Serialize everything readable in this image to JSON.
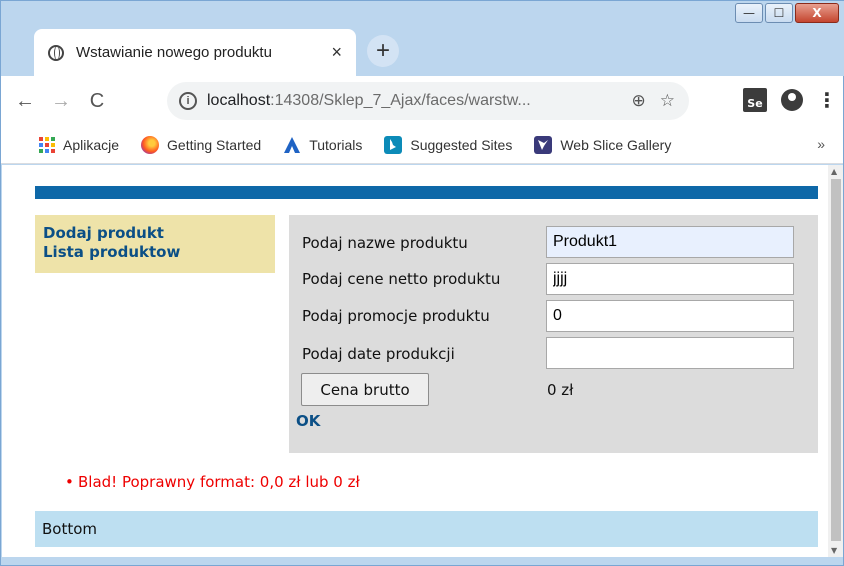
{
  "browser": {
    "tab_title": "Wstawianie nowego produktu",
    "tab_close": "×",
    "new_tab": "+",
    "url_host": "localhost",
    "url_path": ":14308/Sklep_7_Ajax/faces/warstw...",
    "info_glyph": "i",
    "window_buttons": {
      "minimize": "—",
      "maximize": "☐",
      "close": "X"
    },
    "nav": {
      "back": "←",
      "forward": "→",
      "reload": "C"
    },
    "omni_icons": {
      "zoom": "⊕",
      "star": "☆"
    },
    "se_label": "Se",
    "menu_glyph": "⋮",
    "bookmarks": [
      {
        "label": "Aplikacje",
        "icon": "apps-grid-icon"
      },
      {
        "label": "Getting Started",
        "icon": "firefox-icon"
      },
      {
        "label": "Tutorials",
        "icon": "tutorials-icon"
      },
      {
        "label": "Suggested Sites",
        "icon": "bing-icon"
      },
      {
        "label": "Web Slice Gallery",
        "icon": "web-slice-icon"
      }
    ],
    "bookmarks_more": "»"
  },
  "page": {
    "menu": {
      "add_product": "Dodaj produkt",
      "product_list": "Lista produktow"
    },
    "form": {
      "name_label": "Podaj nazwe produktu",
      "name_value": "Produkt1",
      "net_price_label": "Podaj cene netto produktu",
      "net_price_value": "jjjj",
      "promo_label": "Podaj promocje produktu",
      "promo_value": "0",
      "date_label": "Podaj date produkcji",
      "date_value": "",
      "gross_button": "Cena brutto",
      "gross_value": "0 zł",
      "ok_link": "OK"
    },
    "error": "Blad! Poprawny format: 0,0 zł lub 0 zł",
    "bottom": "Bottom"
  },
  "colors": {
    "top_bar": "#0e68a8",
    "menu_bg": "#eee3a9",
    "link": "#0b4f86",
    "form_bg": "#dcdcdc",
    "error": "#ee0000",
    "bottom_bg": "#bddff1"
  }
}
